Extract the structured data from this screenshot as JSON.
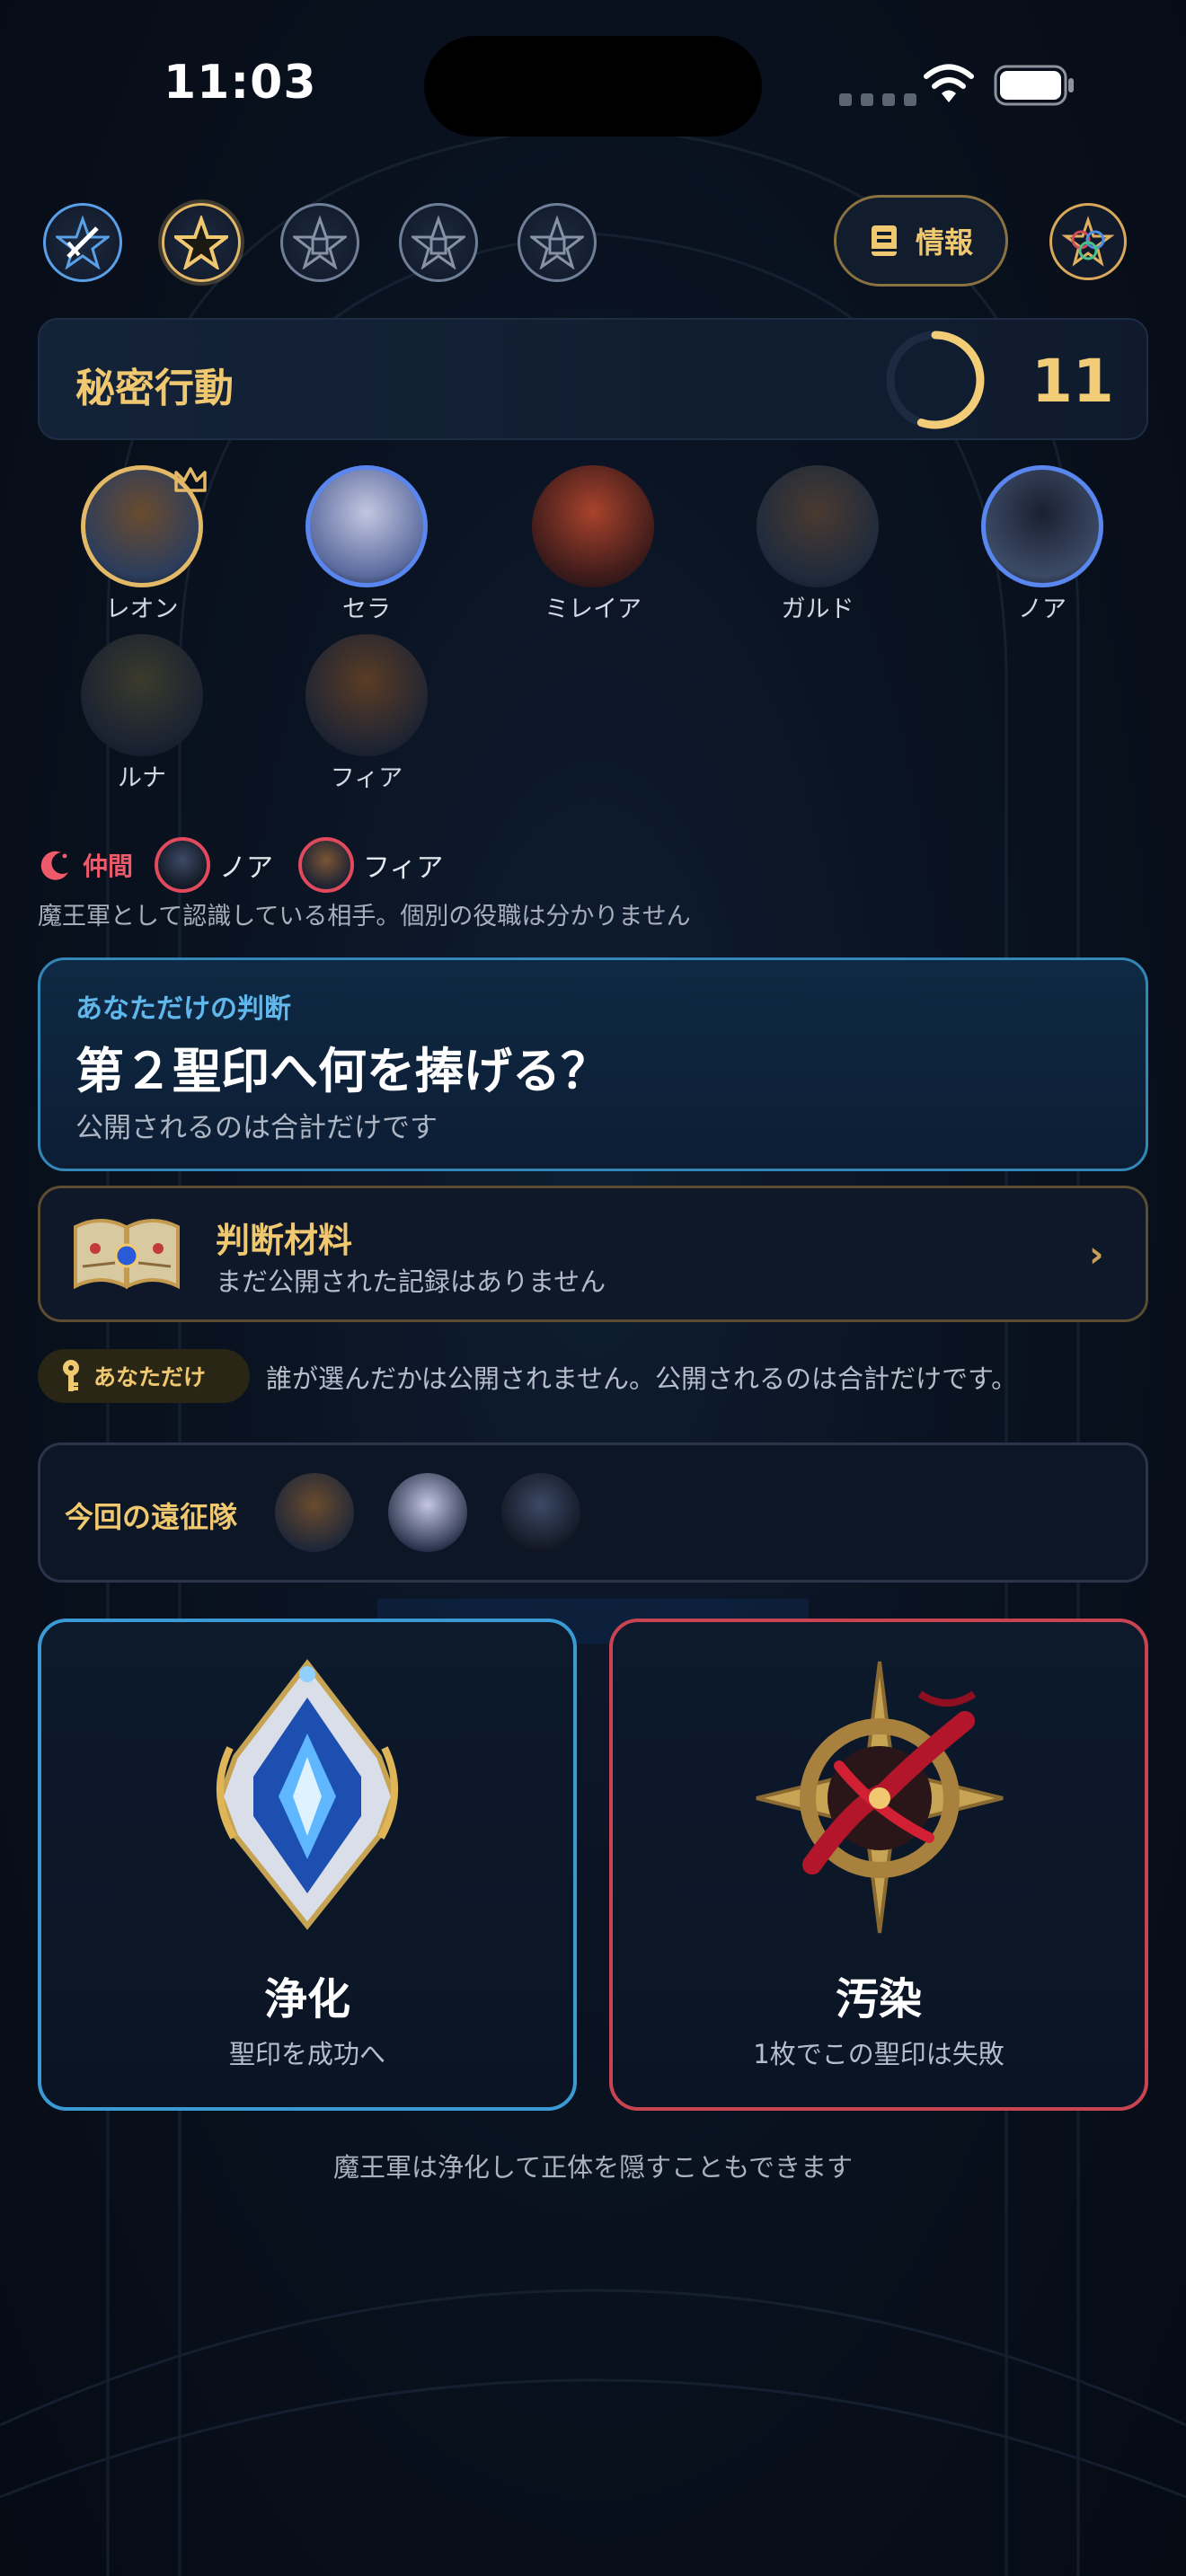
{
  "status_bar": {
    "time": "11:03"
  },
  "header": {
    "role_icons": [
      {
        "name": "crossed-swords-pentagram-icon",
        "state": "done"
      },
      {
        "name": "star-icon",
        "state": "current"
      },
      {
        "name": "pentagram-icon",
        "state": "pending"
      },
      {
        "name": "pentagram-icon",
        "state": "pending"
      },
      {
        "name": "pentagram-icon",
        "state": "pending"
      }
    ],
    "info_button_label": "情報"
  },
  "phase": {
    "title": "秘密行動",
    "timer": "11",
    "timer_fraction": 0.55
  },
  "players": [
    {
      "name": "レオン",
      "ring": "gold",
      "leader": true,
      "colors": [
        "#6a4b2e",
        "#2c3d5c"
      ]
    },
    {
      "name": "セラ",
      "ring": "blue",
      "leader": false,
      "colors": [
        "#c3c6e0",
        "#5b6b9e"
      ]
    },
    {
      "name": "ミレイア",
      "ring": "none",
      "leader": false,
      "colors": [
        "#a8432c",
        "#3b1a1a"
      ]
    },
    {
      "name": "ガルド",
      "ring": "none",
      "leader": false,
      "colors": [
        "#4a3a30",
        "#1e2a3c"
      ]
    },
    {
      "name": "ノア",
      "ring": "blue",
      "leader": false,
      "colors": [
        "#1a2030",
        "#3c4a66"
      ]
    },
    {
      "name": "ルナ",
      "ring": "none",
      "leader": false,
      "colors": [
        "#3b3a2c",
        "#1a2232"
      ]
    },
    {
      "name": "フィア",
      "ring": "none",
      "leader": false,
      "colors": [
        "#5a3c24",
        "#1f2433"
      ]
    }
  ],
  "allies": {
    "label": "仲間",
    "members": [
      "ノア",
      "フィア"
    ],
    "note": "魔王軍として認識している相手。個別の役職は分かりません"
  },
  "decision": {
    "label": "あなただけの判断",
    "title": "第２聖印へ何を捧げる？",
    "subtitle": "公開されるのは合計だけです"
  },
  "material": {
    "title": "判断材料",
    "subtitle": "まだ公開された記録はありません"
  },
  "privacy": {
    "badge": "あなただけ",
    "note": "誰が選んだかは公開されません。公開されるのは合計だけです。"
  },
  "expedition": {
    "label": "今回の遠征隊"
  },
  "choices": {
    "purify": {
      "title": "浄化",
      "subtitle": "聖印を成功へ"
    },
    "corrupt": {
      "title": "汚染",
      "subtitle": "1枚でこの聖印は失敗"
    }
  },
  "footer_note": "魔王軍は浄化して正体を隠すこともできます",
  "colors": {
    "gold": "#f0c870",
    "blue_accent": "#3a9bd4",
    "red_accent": "#c94452",
    "ally_red": "#ef5a6a"
  }
}
